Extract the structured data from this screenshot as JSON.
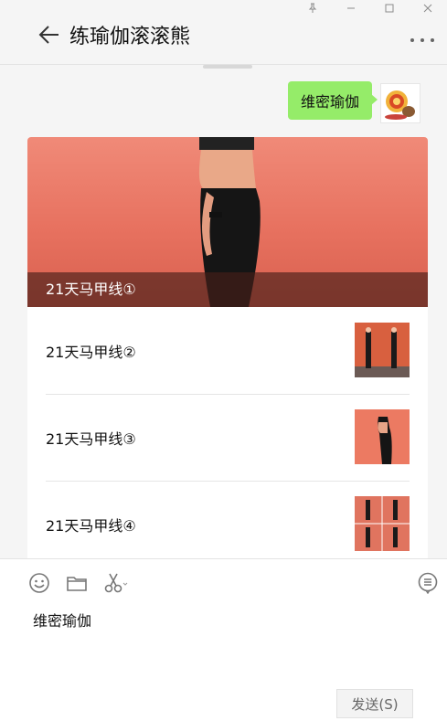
{
  "chat": {
    "title": "练瑜伽滚滚熊"
  },
  "message": {
    "text": "维密瑜伽"
  },
  "article_card": {
    "cover_title": "21天马甲线①",
    "items": [
      {
        "title": "21天马甲线②"
      },
      {
        "title": "21天马甲线③"
      },
      {
        "title": "21天马甲线④"
      }
    ]
  },
  "input": {
    "draft": "维密瑜伽",
    "send_label": "发送(S)"
  },
  "colors": {
    "bubble": "#95ec69",
    "background": "#f5f5f5",
    "cover": "#e7715f"
  },
  "icons": [
    "pin-icon",
    "minimize-icon",
    "maximize-icon",
    "close-icon",
    "back-arrow-icon",
    "more-icon",
    "emoji-icon",
    "folder-icon",
    "scissors-icon",
    "chat-history-icon"
  ]
}
